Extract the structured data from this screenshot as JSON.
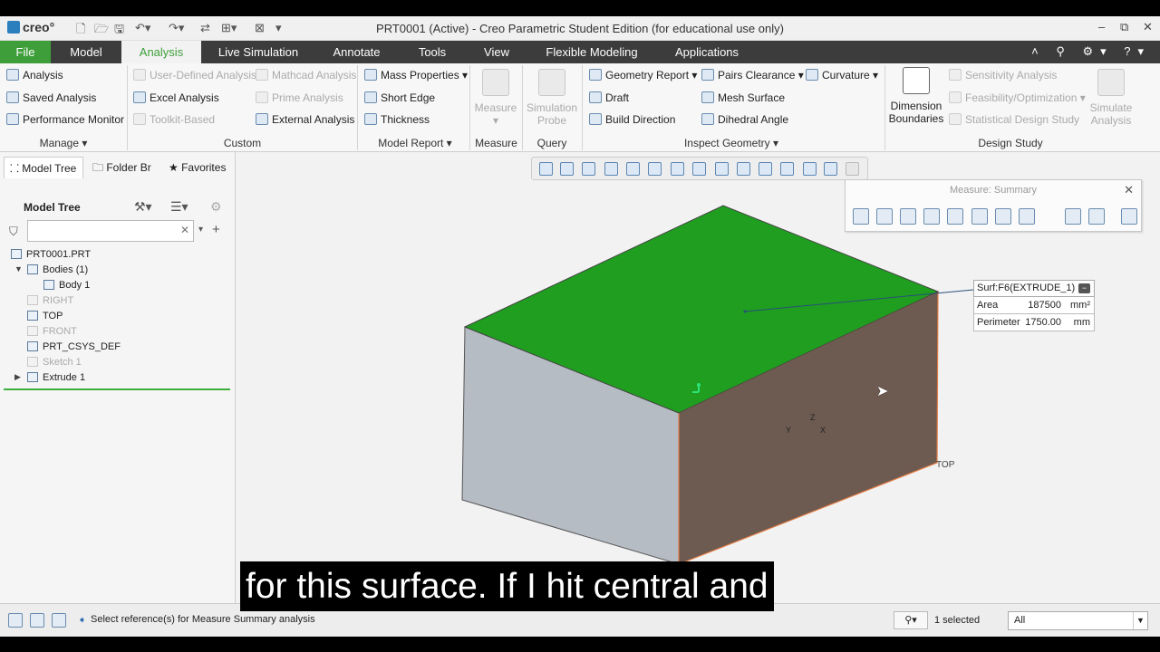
{
  "window": {
    "title": "PRT0001 (Active) - Creo Parametric Student Edition (for educational use only)",
    "logo": "creo°",
    "controls": [
      "–",
      "⧉",
      "✕"
    ]
  },
  "tabs": [
    "File",
    "Model",
    "Analysis",
    "Live Simulation",
    "Annotate",
    "Tools",
    "View",
    "Flexible Modeling",
    "Applications"
  ],
  "ribbon": {
    "manage": {
      "items": [
        "Analysis",
        "Saved Analysis",
        "Performance Monitor"
      ],
      "label": "Manage"
    },
    "custom": {
      "col1": [
        "User-Defined Analysis",
        "Excel Analysis",
        "Toolkit-Based"
      ],
      "col2": [
        "Mathcad Analysis",
        "Prime Analysis",
        "External Analysis"
      ],
      "label": "Custom"
    },
    "model_report": {
      "items": [
        "Mass Properties",
        "Short Edge",
        "Thickness"
      ],
      "label": "Model Report"
    },
    "measure": {
      "button_line1": "Measure",
      "label": "Measure"
    },
    "query": {
      "button_line1": "Simulation",
      "button_line2": "Probe",
      "label": "Query"
    },
    "inspect_geometry": {
      "col1": [
        "Geometry Report",
        "Draft",
        "Build Direction"
      ],
      "col2": [
        "Pairs Clearance",
        "Mesh Surface",
        "Dihedral Angle"
      ],
      "col3": [
        "Curvature"
      ],
      "label": "Inspect Geometry"
    },
    "design_study": {
      "dim_line1": "Dimension",
      "dim_line2": "Boundaries",
      "items": [
        "Sensitivity Analysis",
        "Feasibility/Optimization",
        "Statistical Design Study"
      ],
      "sim_line1": "Simulate",
      "sim_line2": "Analysis",
      "label": "Design Study"
    }
  },
  "left_panel": {
    "tabs": [
      "Model Tree",
      "Folder Br",
      "Favorites"
    ],
    "header": "Model Tree",
    "tree": [
      {
        "label": "PRT0001.PRT",
        "dim": false
      },
      {
        "label": "Bodies (1)",
        "dim": false
      },
      {
        "label": "Body 1",
        "dim": false
      },
      {
        "label": "RIGHT",
        "dim": true
      },
      {
        "label": "TOP",
        "dim": false
      },
      {
        "label": "FRONT",
        "dim": true
      },
      {
        "label": "PRT_CSYS_DEF",
        "dim": false
      },
      {
        "label": "Sketch 1",
        "dim": true
      },
      {
        "label": "Extrude 1",
        "dim": false
      }
    ]
  },
  "measure_panel": {
    "title": "Measure: Summary"
  },
  "surface_info": {
    "name": "Surf:F6(EXTRUDE_1)",
    "rows": [
      {
        "key": "Area",
        "value": "187500",
        "unit": "mm²"
      },
      {
        "key": "Perimeter",
        "value": "1750.00",
        "unit": "mm"
      }
    ]
  },
  "viewport_labels": {
    "datum_top": "TOP",
    "csys_z": "Z",
    "csys_y": "Y",
    "csys_x": "X"
  },
  "colors": {
    "top_face": "#1f9e1f",
    "left_face": "#b6bcc4",
    "right_face": "#6d5a51",
    "accent": "#3e9e3a"
  },
  "subtitle": "for this surface. If I hit central and",
  "status": {
    "message": "Select reference(s) for Measure Summary analysis",
    "selected": "1 selected",
    "filter": "All"
  }
}
